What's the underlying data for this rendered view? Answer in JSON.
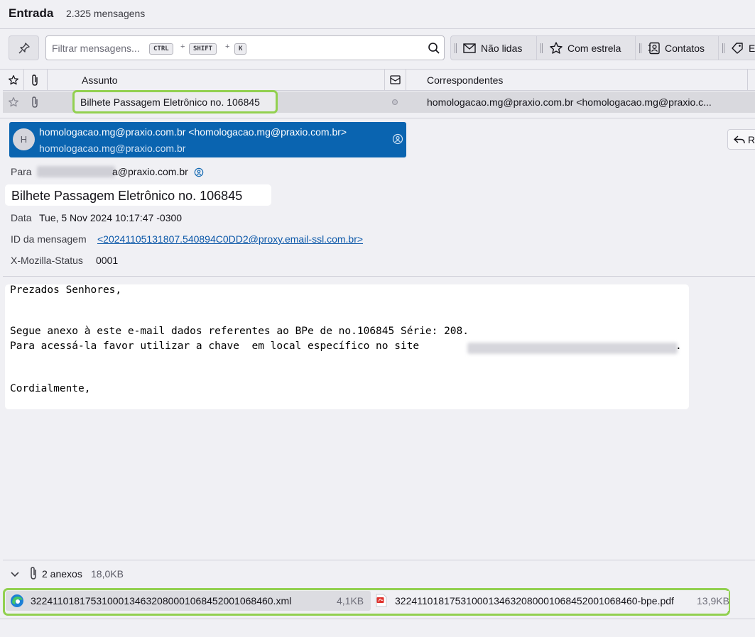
{
  "folder": {
    "name": "Entrada",
    "count": "2.325 mensagens"
  },
  "filter": {
    "placeholder": "Filtrar mensagens...",
    "shortcut": [
      "CTRL",
      "SHIFT",
      "K"
    ],
    "plus": "+"
  },
  "quick_filters": [
    {
      "label": "Não lidas",
      "icon": "envelope-icon"
    },
    {
      "label": "Com estrela",
      "icon": "star-icon"
    },
    {
      "label": "Contatos",
      "icon": "contacts-icon"
    },
    {
      "label": "E",
      "icon": "tag-icon"
    }
  ],
  "columns": {
    "subject": "Assunto",
    "correspondents": "Correspondentes"
  },
  "message_row": {
    "subject": "Bilhete Passagem Eletrônico no. 106845",
    "correspondent": "homologacao.mg@praxio.com.br <homologacao.mg@praxio.c..."
  },
  "header": {
    "avatar_initial": "H",
    "from_main": "homologacao.mg@praxio.com.br <homologacao.mg@praxio.com.br>",
    "from_sub": "homologacao.mg@praxio.com.br",
    "reply_label": "R",
    "to_label": "Para",
    "to_value": "a@praxio.com.br",
    "subject": "Bilhete Passagem Eletrônico no. 106845",
    "date_label": "Data",
    "date_value": "Tue, 5 Nov 2024 10:17:47 -0300",
    "msgid_label": "ID da mensagem",
    "msgid_value": "<20241105131807.540894C0DD2@proxy.email-ssl.com.br>",
    "status_label": "X-Mozilla-Status",
    "status_value": "0001"
  },
  "body": {
    "line1": "Prezados Senhores,",
    "line2": "Segue anexo à este e-mail dados referentes ao BPe de no.106845 Série: 208.",
    "line3": "Para acessá-la favor utilizar a chave  em local específico no site",
    "line3_end": ".",
    "line4": "Cordialmente,"
  },
  "attachments": {
    "count_label": "2 anexos",
    "total_size": "18,0KB",
    "items": [
      {
        "name": "32241101817531000134632080001068452001068460.xml",
        "size": "4,1KB",
        "icon": "edge-browser-icon"
      },
      {
        "name": "32241101817531000134632080001068452001068460-bpe.pdf",
        "size": "13,9KB",
        "icon": "pdf-icon"
      }
    ]
  },
  "colors": {
    "accent_blue": "#0a64b0",
    "highlight_green": "#92d050"
  }
}
